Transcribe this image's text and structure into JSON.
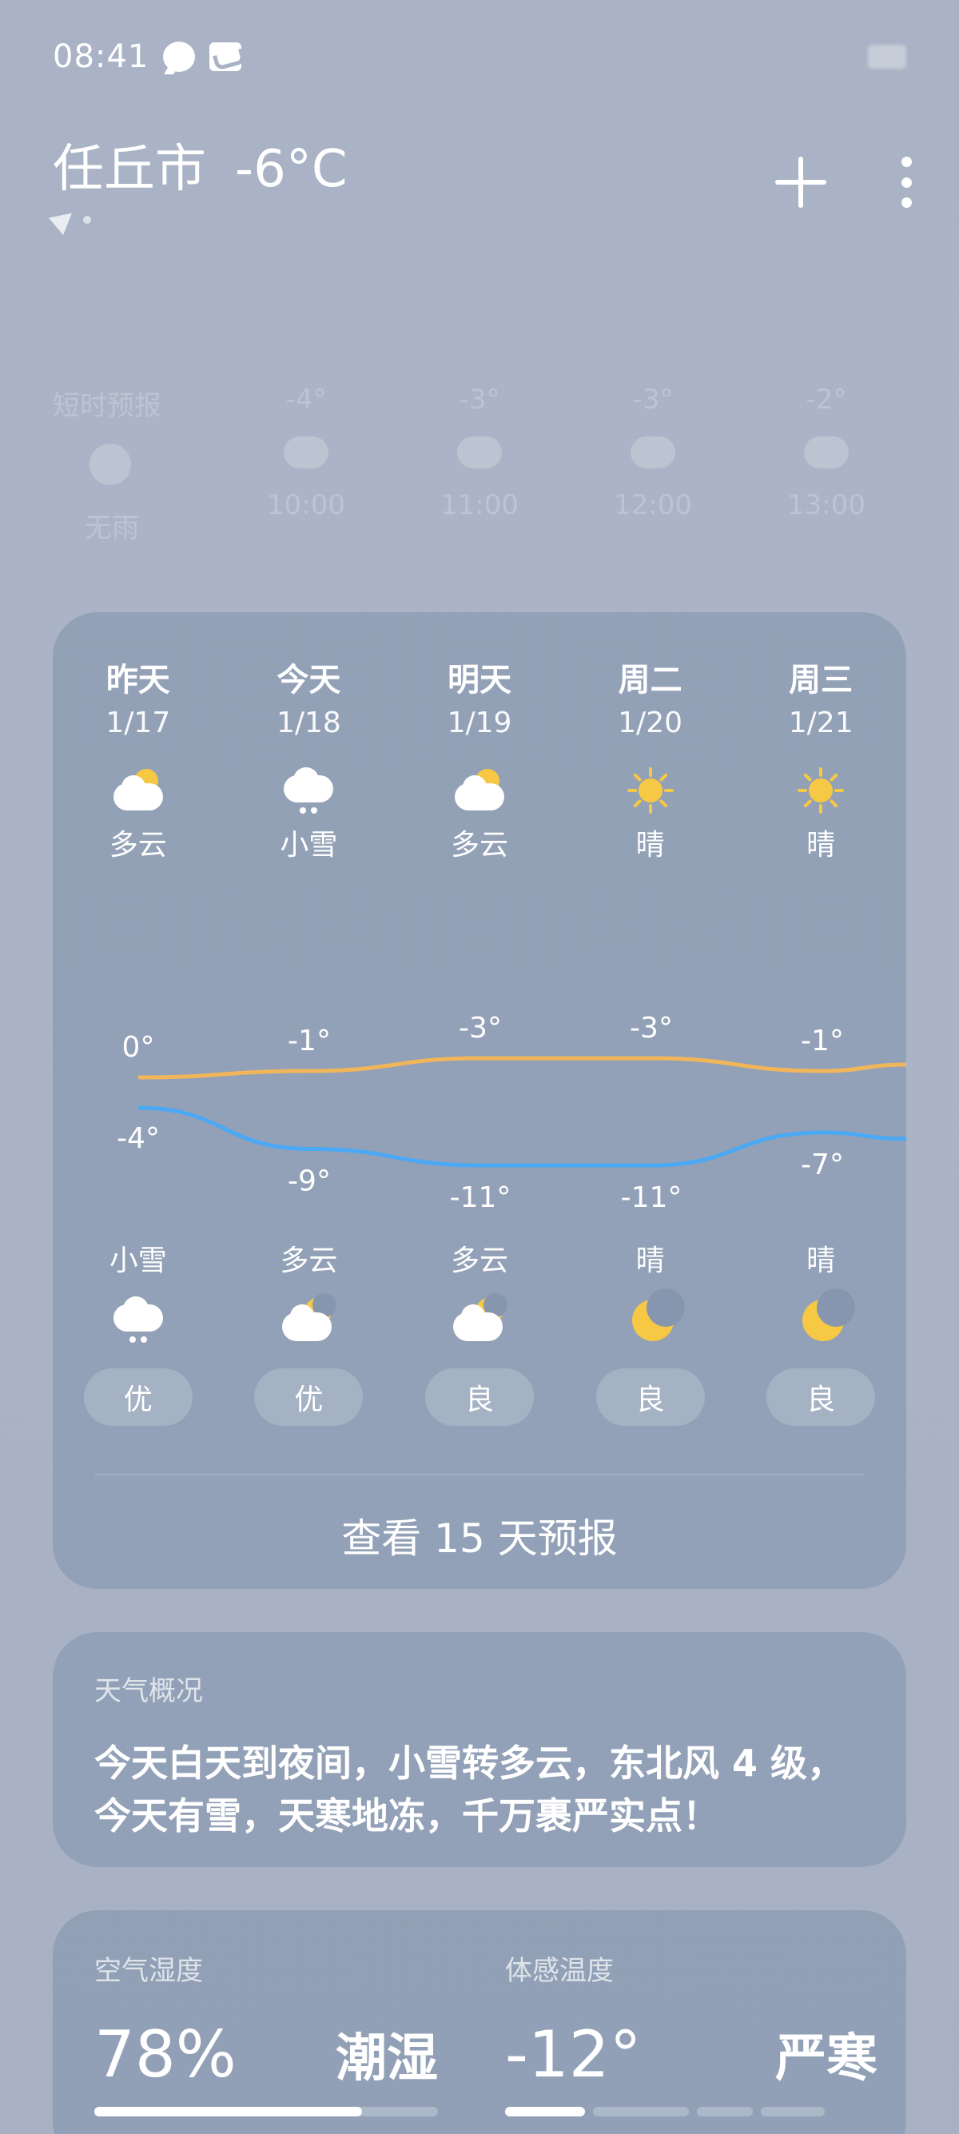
{
  "status_bar": {
    "time": "08:41"
  },
  "header": {
    "city": "任丘市",
    "current_temp": "-6°C"
  },
  "hourly": [
    {
      "label": "短时预报",
      "value": "无雨",
      "icon": "clock-icon"
    },
    {
      "label": "-4°",
      "value": "10:00",
      "icon": "cloud-icon"
    },
    {
      "label": "-3°",
      "value": "11:00",
      "icon": "snow-icon"
    },
    {
      "label": "-3°",
      "value": "12:00",
      "icon": "cloud-icon"
    },
    {
      "label": "-2°",
      "value": "13:00",
      "icon": "cloud-icon"
    }
  ],
  "forecast": {
    "days": [
      {
        "name": "昨天",
        "date": "1/17",
        "day_cond": "多云",
        "day_icon": "partly-cloudy-icon",
        "high": "0°",
        "low": "-4°",
        "night_cond": "小雪",
        "night_icon": "snow-icon",
        "aqi": "优"
      },
      {
        "name": "今天",
        "date": "1/18",
        "day_cond": "小雪",
        "day_icon": "snow-icon",
        "high": "-1°",
        "low": "-9°",
        "night_cond": "多云",
        "night_icon": "cloudy-night-icon",
        "aqi": "优"
      },
      {
        "name": "明天",
        "date": "1/19",
        "day_cond": "多云",
        "day_icon": "partly-cloudy-icon",
        "high": "-3°",
        "low": "-11°",
        "night_cond": "多云",
        "night_icon": "cloudy-night-icon",
        "aqi": "良"
      },
      {
        "name": "周二",
        "date": "1/20",
        "day_cond": "晴",
        "day_icon": "sun-icon",
        "high": "-3°",
        "low": "-11°",
        "night_cond": "晴",
        "night_icon": "moon-icon",
        "aqi": "良"
      },
      {
        "name": "周三",
        "date": "1/21",
        "day_cond": "晴",
        "day_icon": "sun-icon",
        "high": "-1°",
        "low": "-7°",
        "night_cond": "晴",
        "night_icon": "moon-icon",
        "aqi": "良"
      }
    ],
    "high_values": [
      0,
      -1,
      -3,
      -3,
      -1
    ],
    "low_values": [
      -4,
      -9,
      -11,
      -11,
      -7
    ],
    "high_color": "#f2b65a",
    "low_color": "#4aa8f5",
    "more_label": "查看 15 天预报"
  },
  "summary": {
    "title": "天气概况",
    "text": "今天白天到夜间，小雪转多云，东北风 4 级，今天有雪，天寒地冻，千万裹严实点！"
  },
  "details": {
    "humidity": {
      "label": "空气湿度",
      "value": "78%",
      "desc": "潮湿",
      "level": 0.78
    },
    "feels_like": {
      "label": "体感温度",
      "value": "-12°",
      "desc": "严寒"
    }
  }
}
